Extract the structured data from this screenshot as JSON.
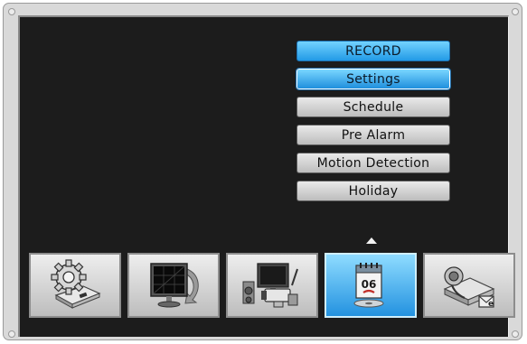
{
  "menu": {
    "header": "RECORD",
    "items": [
      {
        "label": "Settings",
        "selected": true
      },
      {
        "label": "Schedule",
        "selected": false
      },
      {
        "label": "Pre Alarm",
        "selected": false
      },
      {
        "label": "Motion Detection",
        "selected": false
      },
      {
        "label": "Holiday",
        "selected": false
      }
    ]
  },
  "toolbar": {
    "tiles": [
      {
        "icon": "system-setup-icon",
        "selected": false
      },
      {
        "icon": "display-monitor-icon",
        "selected": false
      },
      {
        "icon": "camera-device-icon",
        "selected": false
      },
      {
        "icon": "record-calendar-icon",
        "selected": true,
        "calendar_day": "06"
      },
      {
        "icon": "network-icon",
        "selected": false
      }
    ]
  },
  "colors": {
    "accent": "#229ae6",
    "screen_background": "#1c1c1c",
    "bezel": "#d9d9d9"
  }
}
